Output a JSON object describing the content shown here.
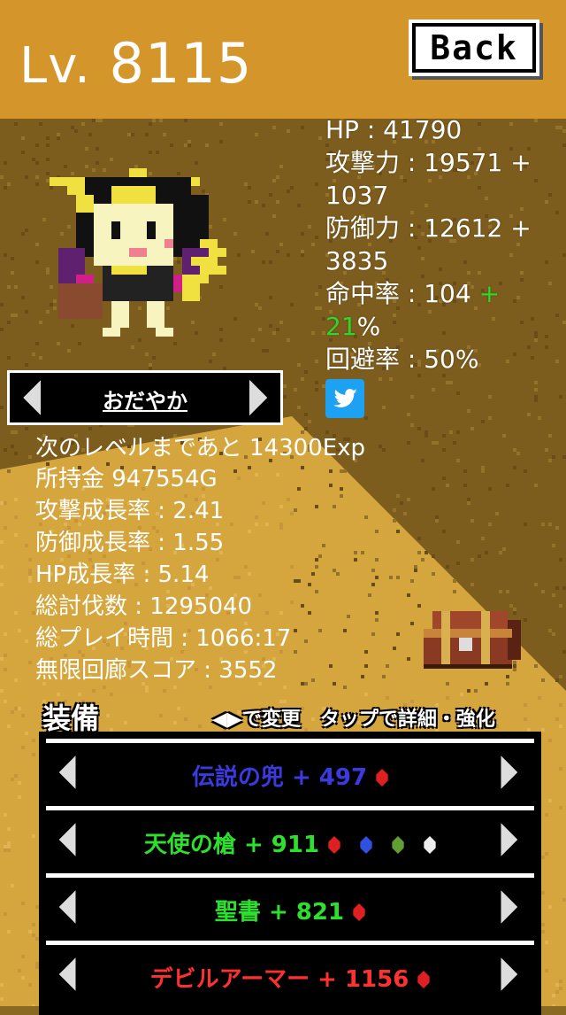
{
  "header": {
    "level_prefix": "Lv.",
    "level_value": "8115",
    "back_label": "Back"
  },
  "stats": {
    "hp": "HP : 41790",
    "attack_a": "攻撃力 : 19571 +",
    "attack_b": "1037",
    "defense_a": "防御力 : 12612 +",
    "defense_b": "3835",
    "accuracy_a": "命中率 : 104 ",
    "accuracy_plus": "+",
    "accuracy_bonus": "21",
    "accuracy_pct": "%",
    "evasion": "回避率 : 50%"
  },
  "personality": {
    "label": "おだやか"
  },
  "info": {
    "next_level": "次のレベルまであと 14300Exp",
    "money": "所持金 947554G",
    "attack_growth": "攻撃成長率 : 2.41",
    "defense_growth": "防御成長率 : 1.55",
    "hp_growth": "HP成長率 : 5.14",
    "kills": "総討伐数 : 1295040",
    "playtime": "総プレイ時間 : 1066:17",
    "infinite_score": "無限回廊スコア : 3552"
  },
  "equipment": {
    "title": "装備",
    "hint": "◀▶で変更　タップで詳細・強化",
    "items": [
      {
        "name": "伝説の兜 + 497",
        "color": "#3a3ae0",
        "gems": [
          "red"
        ]
      },
      {
        "name": "天使の槍 + 911",
        "color": "#2ee02e",
        "gems": [
          "red",
          "blue",
          "green",
          "white"
        ]
      },
      {
        "name": "聖書 + 821",
        "color": "#2ee02e",
        "gems": [
          "red"
        ]
      },
      {
        "name": "デビルアーマー + 1156",
        "color": "#ff3030",
        "gems": [
          "red"
        ]
      }
    ]
  },
  "colors": {
    "header": "#d4952a",
    "ground_dark": "#7a5a1c",
    "ground_light": "#d4a640",
    "accent_green": "#2bd82b",
    "twitter": "#1da1f2"
  },
  "icons": [
    "twitter-icon",
    "treasure-chest-icon",
    "arrow-left-icon",
    "arrow-right-icon",
    "gem-icon"
  ]
}
